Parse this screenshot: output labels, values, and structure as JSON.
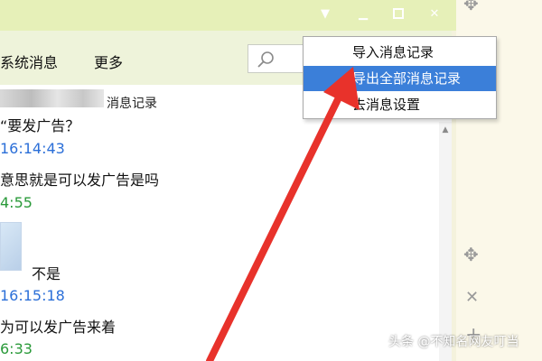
{
  "titlebar": {
    "controls": [
      "chevron-down-icon",
      "minimize-icon",
      "maximize-icon",
      "close-icon"
    ]
  },
  "menu": {
    "system_messages": "系统消息",
    "more": "更多"
  },
  "dropdown": {
    "items": [
      {
        "label": "导入消息记录",
        "active": false
      },
      {
        "label": "导出全部消息记录",
        "active": true
      },
      {
        "label": "去消息设置",
        "active": false
      }
    ]
  },
  "chat": {
    "record_title": "消息记录",
    "messages": [
      {
        "text": "“要发广告？",
        "time": "16:14:43",
        "time_color": "#2b6fd8"
      },
      {
        "text": "意思就是可以发广告是吗",
        "time": "4:55",
        "time_color": "#2a9a3a"
      },
      {
        "text": "不是",
        "time": "16:15:18",
        "time_color": "#2b6fd8"
      },
      {
        "text": "为可以发广告来着",
        "time": "6:33",
        "time_color": "#2a9a3a"
      }
    ]
  },
  "watermark": "头条 @不知名网友叮当",
  "colors": {
    "titlebar": "#e6f0b8",
    "menu_highlight": "#3b7fd9",
    "arrow": "#e8322b",
    "timestamp_blue": "#2b6fd8",
    "timestamp_green": "#2a9a3a"
  }
}
